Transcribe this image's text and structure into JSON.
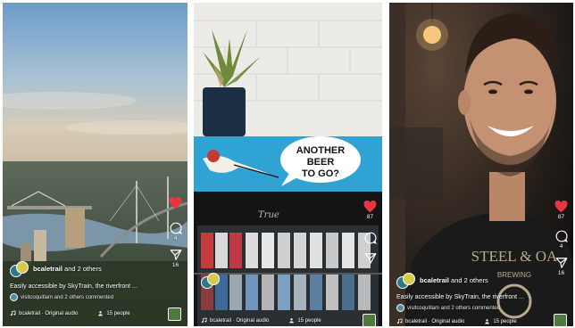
{
  "colors": {
    "like": "#e8353f",
    "text": "#ffffff"
  },
  "panels": [
    {
      "id": "reel-1",
      "likes": "",
      "comments": "4",
      "shares": "16",
      "author": "bcaletrail",
      "author_suffix": " and 2 others",
      "caption": "Easily accessible by SkyTrain, the riverfront ...",
      "comment_text": "visitcoquitlam and 2 others commented",
      "audio": "bcaletrail · Original audio",
      "people": "15 people"
    },
    {
      "id": "reel-2",
      "likes": "87",
      "comments": "",
      "shares": "",
      "author": "",
      "author_suffix": "",
      "caption": "",
      "comment_text": "",
      "audio": "bcaletrail · Original audio",
      "people": "15 people",
      "sign_text": "ANOTHER BEER TO GO?",
      "fridge_brand": "True"
    },
    {
      "id": "reel-3",
      "likes": "87",
      "comments": "4",
      "shares": "16",
      "author": "bcaletrail",
      "author_suffix": " and 2 others",
      "caption": "Easily accessible by SkyTrain, the riverfront ...",
      "comment_text": "visitcoquitlam and 2 others commented",
      "audio": "bcaletrail · Original audio",
      "people": "15 people",
      "shirt_text": "STEEL & OAK BREWING CO"
    }
  ],
  "icons": [
    "heart-icon",
    "comment-bubble-icon",
    "send-icon",
    "music-note-icon",
    "people-icon",
    "audio-thumbnail-icon"
  ]
}
